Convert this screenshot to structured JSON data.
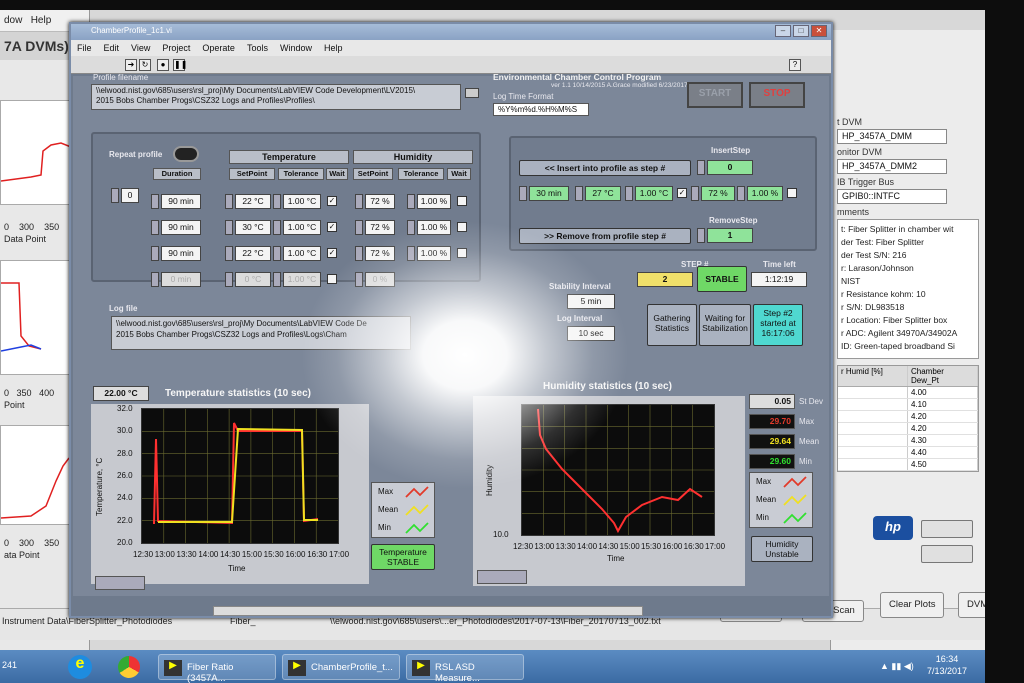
{
  "bg_left": {
    "menu": [
      "dow",
      "Help"
    ],
    "title": "7A DVMs)",
    "plot1_ticks": [
      "0",
      "300",
      "350"
    ],
    "plot1_label": "Data Point",
    "plot2_ticks": [
      "0",
      "350",
      "400"
    ],
    "plot2_label": "Point",
    "plot3_ticks": [
      "0",
      "300",
      "350"
    ],
    "plot3_label": "ata Point"
  },
  "bg_right": {
    "lbl1": "t DVM",
    "field1": "HP_3457A_DMM",
    "lbl2": "onitor DVM",
    "field2": "HP_3457A_DMM2",
    "lbl3": "IB Trigger Bus",
    "field3": "GPIB0::INTFC",
    "lbl4": "mments",
    "comments": [
      "t: Fiber Splitter in chamber wit",
      "",
      "der Test: Fiber Splitter",
      "der Test S/N: 216",
      "r: Larason/Johnson",
      "NIST",
      "r Resistance kohm: 10",
      "r S/N: DL983518",
      "r Location: Fiber Splitter box",
      "r ADC: Agilent 34970A/34902A",
      "ID: Green-taped broadband Si"
    ],
    "table_headers": [
      "r Humid [%]",
      "Chamber Dew_Pt"
    ],
    "table_values": [
      "4.00",
      "4.10",
      "4.20",
      "4.20",
      "4.30",
      "4.40",
      "4.50"
    ],
    "hp_logo": "hp"
  },
  "desktop_bottom": {
    "path_left": "Instrument Data\\FiberSplitter_Photodiodes",
    "path_mid": "Fiber_",
    "path_right": "\\\\elwood.nist.gov\\685\\users\\...er_Photodiodes\\2017-07-13\\Fiber_20170713_002.txt",
    "btn_start_scan": "Start Scan",
    "btn_stop_scan": "Stop Scan",
    "btn_clear_plots": "Clear Plots",
    "btn_dvm": "DVM"
  },
  "taskbar": {
    "left_num": "241",
    "items": [
      "Fiber Ratio (3457A...",
      "ChamberProfile_t...",
      "RSL ASD Measure..."
    ],
    "time": "16:34",
    "date": "7/13/2017"
  },
  "lv": {
    "title": "ChamberProfile_1c1.vi",
    "menu": [
      "File",
      "Edit",
      "View",
      "Project",
      "Operate",
      "Tools",
      "Window",
      "Help"
    ],
    "profile_filename_label": "Profile filename",
    "profile_path": "\\\\elwood.nist.gov\\685\\users\\rsl_proj\\My Documents\\LabVIEW Code Development\\LV2015\\",
    "profile_path2": "2015 Bobs Chamber Progs\\CSZ32 Logs and Profiles\\Profiles\\",
    "app_title": "Environmental Chamber Control Program",
    "version": "ver 1.1   10/14/2015   A.Grace   modified 6/23/2017 J.Larason",
    "log_time_format_label": "Log Time Format",
    "log_time_format": "%Y%m%d.%H%M%S",
    "start": "START",
    "stop": "STOP",
    "repeat_profile": "Repeat profile",
    "hdr_temperature": "Temperature",
    "hdr_humidity": "Humidity",
    "col_duration": "Duration",
    "col_setpoint": "SetPoint",
    "col_tolerance": "Tolerance",
    "col_wait": "Wait",
    "col_hsetpoint": "SetPoint",
    "col_htolerance": "Tolerance",
    "col_hwait": "Wait",
    "index": "0",
    "rows": [
      {
        "dur": "90 min",
        "t": "22 °C",
        "tt": "1.00 °C",
        "h": "72 %",
        "ht": "1.00 %"
      },
      {
        "dur": "90 min",
        "t": "30 °C",
        "tt": "1.00 °C",
        "h": "72 %",
        "ht": "1.00 %"
      },
      {
        "dur": "90 min",
        "t": "22 °C",
        "tt": "1.00 °C",
        "h": "72 %",
        "ht": "1.00 %"
      },
      {
        "dur": "0 min",
        "t": "0 °C",
        "tt": "1.00 °C",
        "h": "0 %",
        "ht": "1.00 %"
      }
    ],
    "insert_btn": "<< Insert into profile as step #",
    "insert_step_label": "InsertStep",
    "insert_step": "0",
    "ins_dur": "30 min",
    "ins_t": "27 °C",
    "ins_tt": "1.00 °C",
    "ins_h": "72 %",
    "ins_ht": "1.00 %",
    "remove_btn": ">> Remove from profile step #",
    "remove_step_label": "RemoveStep",
    "remove_step": "1",
    "log_file_label": "Log file",
    "log_path": "\\\\elwood.nist.gov\\685\\users\\rsl_proj\\My Documents\\LabVIEW Code De",
    "log_path2": "2015 Bobs Chamber Progs\\CSZ32 Logs and Profiles\\Logs\\Cham",
    "stability_interval_label": "Stability Interval",
    "stability_interval": "5 min",
    "log_interval_label": "Log Interval",
    "log_interval": "10 sec",
    "step_label": "STEP #",
    "step": "2",
    "stable": "STABLE",
    "time_left_label": "Time left",
    "time_left": "1:12:19",
    "gathering": "Gathering Statistics",
    "waiting": "Waiting for Stabilization",
    "step_started": "Step #2 started at 16:17:06",
    "temp_current": "22.00 °C",
    "temp_title": "Temperature statistics (10 sec)",
    "temp_ylabel": "Temperature, °C",
    "temp_xlabel": "Time",
    "temp_yticks": [
      "32.0",
      "30.0",
      "28.0",
      "26.0",
      "24.0",
      "22.0",
      "20.0"
    ],
    "xticks": [
      "12:30",
      "13:00",
      "13:30",
      "14:00",
      "14:30",
      "15:00",
      "15:30",
      "16:00",
      "16:30",
      "17:00"
    ],
    "temp_status": "Temperature STABLE",
    "hum_title": "Humidity statistics (10 sec)",
    "hum_ylabel": "Humidity",
    "hum_xlabel": "Time",
    "hum_yticks": [
      "10.0"
    ],
    "stdev": "0.05",
    "stdev_label": "St Dev",
    "max": "29.70",
    "max_label": "Max",
    "mean": "29.64",
    "mean_label": "Mean",
    "min": "29.60",
    "min_label": "Min",
    "legend": [
      "Max",
      "Mean",
      "Min"
    ],
    "hum_status": "Humidity Unstable",
    "colors": {
      "max": "#e23a2a",
      "mean": "#f0e020",
      "min": "#30e030",
      "trace": "#ff3030",
      "stable_green": "#6fd866"
    }
  }
}
